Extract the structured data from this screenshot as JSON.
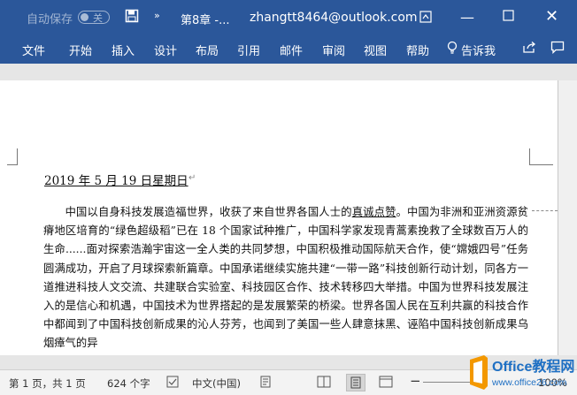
{
  "titlebar": {
    "autosave_label": "自动保存",
    "autosave_state": "关",
    "doc_name": "第8章 -...",
    "account": "zhangtt8464@outlook.com"
  },
  "ribbon": {
    "tabs": [
      "文件",
      "开始",
      "插入",
      "设计",
      "布局",
      "引用",
      "邮件",
      "审阅",
      "视图",
      "帮助"
    ],
    "tell_me": "告诉我"
  },
  "document": {
    "date_line": "2019 年 5 月 19 日星期日",
    "paragraph_before_link": "中国以自身科技发展造福世界，收获了来自世界各国人士的",
    "link_text": "真诚点赞",
    "paragraph_after_link": "。中国为非洲和亚洲资源贫瘠地区培育的“绿色超级稻”已在 18 个国家试种推广，中国科学家发现青蒿素挽救了全球数百万人的生命......面对探索浩瀚宇宙这一全人类的共同梦想，中国积极推动国际航天合作，使“嫦娥四号”任务圆满成功，开启了月球探索新篇章。中国承诺继续实施共建“一带一路”科技创新行动计划，同各方一道推进科技人文交流、共建联合实验室、科技园区合作、技术转移四大举措。中国为世界科技发展注入的是信心和机遇，中国技术为世界搭起的是发展繁荣的桥梁。世界各国人民在互利共赢的科技合作中都闻到了中国科技创新成果的沁人芬芳，也闻到了美国一些人肆意抹黑、诬陷中国科技创新成果乌烟瘴气的异"
  },
  "statusbar": {
    "page_info": "第 1 页，共 1 页",
    "word_count": "624 个字",
    "language": "中文(中国)",
    "zoom": "100%"
  },
  "watermark": {
    "brand": "Office教程网",
    "url": "www.office26.com"
  },
  "colors": {
    "ribbon_blue": "#2b579a",
    "watermark_orange": "#f39800",
    "watermark_blue": "#1e6fc3"
  }
}
